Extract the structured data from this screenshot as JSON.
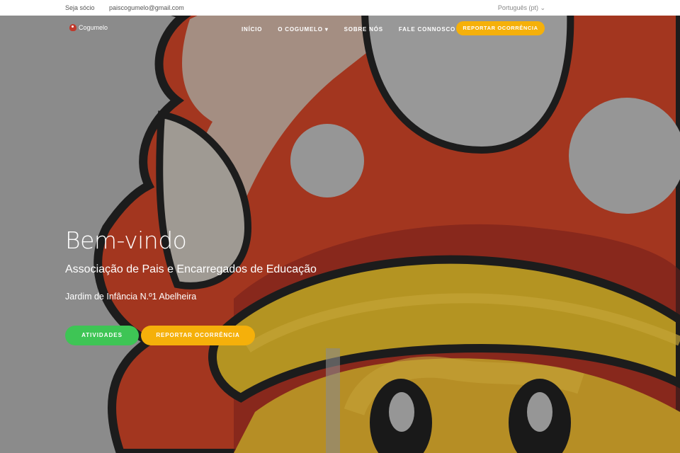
{
  "topbar": {
    "member_label": "Seja sócio",
    "email": "paiscogumelo@gmail.com",
    "language": "Português (pt) ⌄"
  },
  "logo": {
    "text": "Cogumelo"
  },
  "nav": {
    "items": [
      "INÍCIO",
      "O COGUMELO ▾",
      "SOBRE NÓS",
      "FALE CONNOSCO"
    ],
    "report_button": "REPORTAR OCORRÊNCIA"
  },
  "hero": {
    "title": "Bem-vindo",
    "subtitle": "Associação de Pais e Encarregados de Educação",
    "school": "Jardim de Infância N.º1 Abelheira",
    "activities_button": "ATIVIDADES",
    "report_button": "REPORTAR OCORRÊNCIA"
  },
  "colors": {
    "green": "#3ec555",
    "yellow": "#f5b00a",
    "red": "#b8341c"
  }
}
